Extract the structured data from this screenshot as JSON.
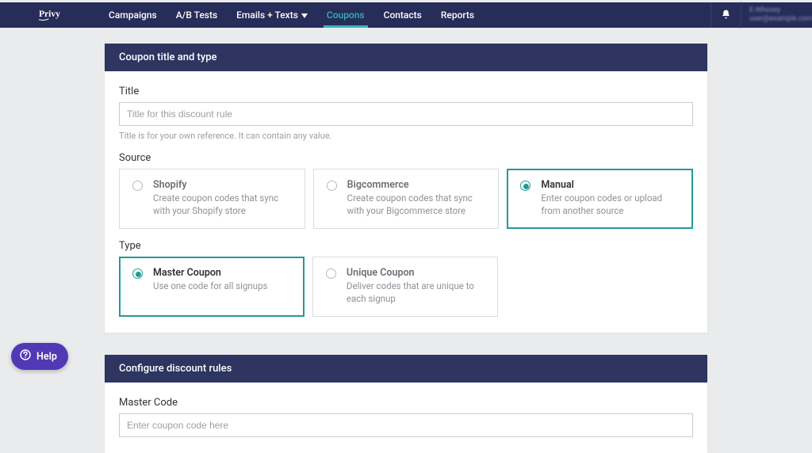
{
  "brand": "Privy",
  "nav": {
    "items": [
      {
        "label": "Campaigns"
      },
      {
        "label": "A/B Tests"
      },
      {
        "label": "Emails + Texts",
        "caret": true
      },
      {
        "label": "Coupons",
        "active": true
      },
      {
        "label": "Contacts"
      },
      {
        "label": "Reports"
      }
    ],
    "user_line1": "E-Whosey",
    "user_line2": "user@example.com"
  },
  "panel1": {
    "header": "Coupon title and type",
    "title_label": "Title",
    "title_placeholder": "Title for this discount rule",
    "title_help": "Title is for your own reference. It can contain any value.",
    "source_label": "Source",
    "sources": [
      {
        "title": "Shopify",
        "desc": "Create coupon codes that sync with your Shopify store"
      },
      {
        "title": "Bigcommerce",
        "desc": "Create coupon codes that sync with your Bigcommerce store"
      },
      {
        "title": "Manual",
        "desc": "Enter coupon codes or upload from another source",
        "selected": true
      }
    ],
    "type_label": "Type",
    "types": [
      {
        "title": "Master Coupon",
        "desc": "Use one code for all signups",
        "selected": true
      },
      {
        "title": "Unique Coupon",
        "desc": "Deliver codes that are unique to each signup"
      }
    ]
  },
  "panel2": {
    "header": "Configure discount rules",
    "master_code_label": "Master Code",
    "master_code_placeholder": "Enter coupon code here"
  },
  "help": {
    "label": "Help"
  }
}
